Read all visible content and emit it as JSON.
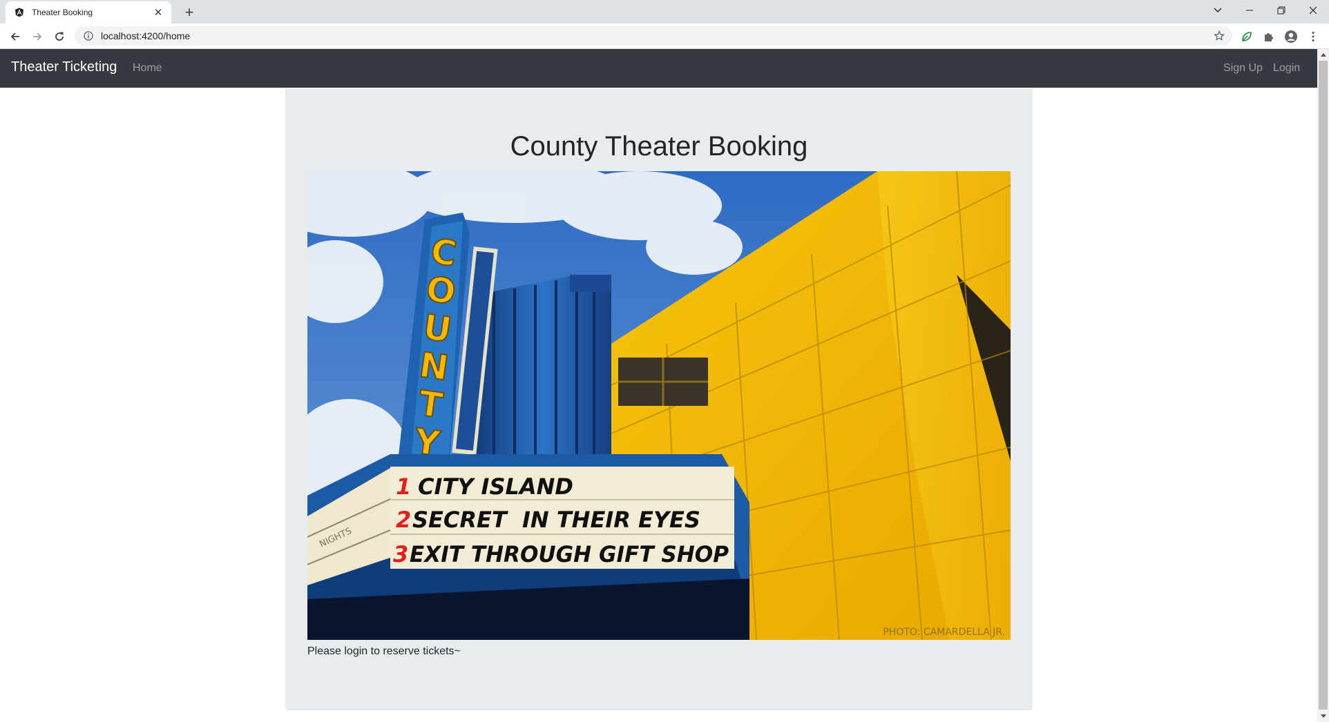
{
  "browser": {
    "tab_title": "Theater Booking",
    "url": "localhost:4200/home"
  },
  "navbar": {
    "brand": "Theater Ticketing",
    "home": "Home",
    "signup": "Sign Up",
    "login": "Login"
  },
  "main": {
    "title": "County Theater Booking",
    "message": "Please login to reserve tickets~"
  },
  "hero_image": {
    "sign_letters": [
      "C",
      "O",
      "U",
      "N",
      "T",
      "Y"
    ],
    "marquee": [
      {
        "num": "1",
        "text": "CITY ISLAND"
      },
      {
        "num": "2",
        "text": "SECRET  IN THEIR EYES"
      },
      {
        "num": "3",
        "text": "EXIT THROUGH GIFT SHOP"
      }
    ],
    "side_text": "NIGHTS",
    "credit": "PHOTO: CAMARDELLA JR."
  },
  "colors": {
    "navbar_bg": "#343a40",
    "jumbotron_bg": "#e9ecef",
    "building_yellow": "#f2b707",
    "sign_blue": "#1f62b0",
    "marquee_red": "#e0201c"
  }
}
